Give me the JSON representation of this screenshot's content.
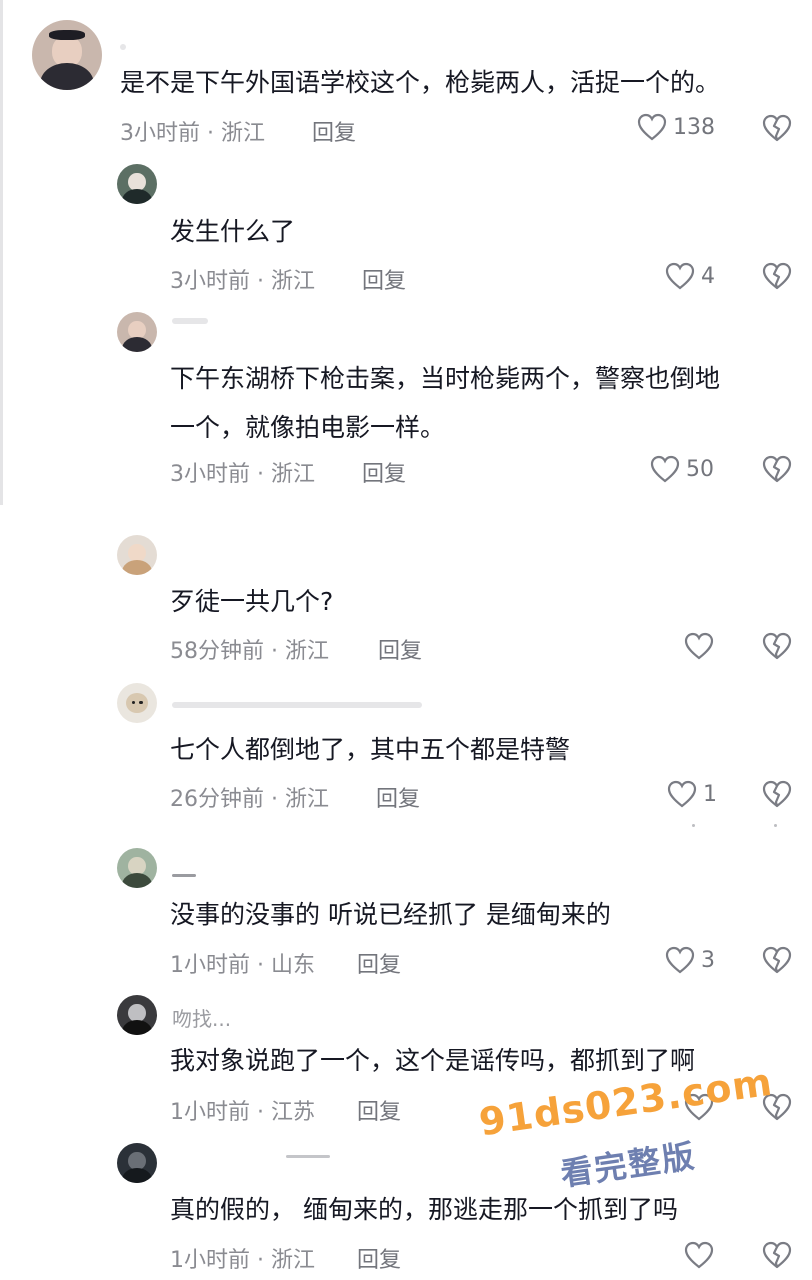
{
  "comments": [
    {
      "text": "是不是下午外国语学校这个，枪毙两人，活捉一个的。",
      "meta": "3小时前 · 浙江",
      "reply": "回复",
      "likes": "138"
    },
    {
      "text": "发生什么了",
      "meta": "3小时前 · 浙江",
      "reply": "回复",
      "likes": "4"
    },
    {
      "text_line1": "下午东湖桥下枪击案，当时枪毙两个，警察也倒地",
      "text_line2": "一个，就像拍电影一样。",
      "meta": "3小时前 · 浙江",
      "reply": "回复",
      "likes": "50"
    },
    {
      "text": "歹徒一共几个?",
      "meta": "58分钟前 · 浙江",
      "reply": "回复",
      "likes": ""
    },
    {
      "text": "七个人都倒地了，其中五个都是特警",
      "meta": "26分钟前 · 浙江",
      "reply": "回复",
      "likes": "1"
    },
    {
      "text": "没事的没事的 听说已经抓了 是缅甸来的",
      "meta": "1小时前 · 山东",
      "reply": "回复",
      "likes": "3"
    },
    {
      "username": "吻找...",
      "text": "我对象说跑了一个，这个是谣传吗，都抓到了啊",
      "meta": "1小时前 · 江苏",
      "reply": "回复",
      "likes": ""
    },
    {
      "text": "真的假的， 缅甸来的，那逃走那一个抓到了吗",
      "meta": "1小时前 · 浙江",
      "reply": "回复",
      "likes": ""
    }
  ],
  "watermark": {
    "site": "91ds023.com",
    "caption": "看完整版"
  },
  "colors": {
    "text": "#161823",
    "meta": "#8a8b91",
    "watermark_site": "#f6a23a",
    "watermark_caption": "#6e7fb0"
  }
}
